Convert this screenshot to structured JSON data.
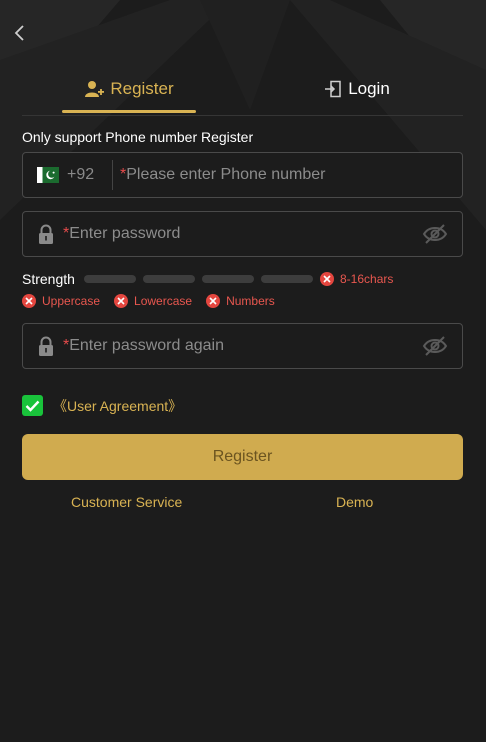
{
  "header": {
    "back_icon": "chevron-left-icon"
  },
  "tabs": [
    {
      "label": "Register",
      "icon": "user-add-icon",
      "active": true
    },
    {
      "label": "Login",
      "icon": "login-door-icon",
      "active": false
    }
  ],
  "form": {
    "notice": "Only support Phone number Register",
    "phone": {
      "country_code": "+92",
      "flag": "pakistan-flag-icon",
      "required_mark": "*",
      "placeholder": "Please enter Phone number"
    },
    "password": {
      "required_mark": "*",
      "placeholder": "Enter password",
      "icon": "lock-icon",
      "toggle_icon": "eye-off-icon"
    },
    "strength": {
      "label": "Strength",
      "level": 0,
      "segments": 4,
      "rules": [
        "8-16chars",
        "Uppercase",
        "Lowercase",
        "Numbers"
      ]
    },
    "confirm_password": {
      "required_mark": "*",
      "placeholder": "Enter password again",
      "icon": "lock-icon",
      "toggle_icon": "eye-off-icon"
    },
    "agreement": {
      "checked": true,
      "label": "《User Agreement》"
    },
    "submit_label": "Register"
  },
  "footer": {
    "customer_service": "Customer Service",
    "demo": "Demo"
  },
  "colors": {
    "accent": "#d9b353",
    "button": "#d0ab4f",
    "error": "#e4463f",
    "check": "#19c33b",
    "background": "#1c1c1c"
  }
}
